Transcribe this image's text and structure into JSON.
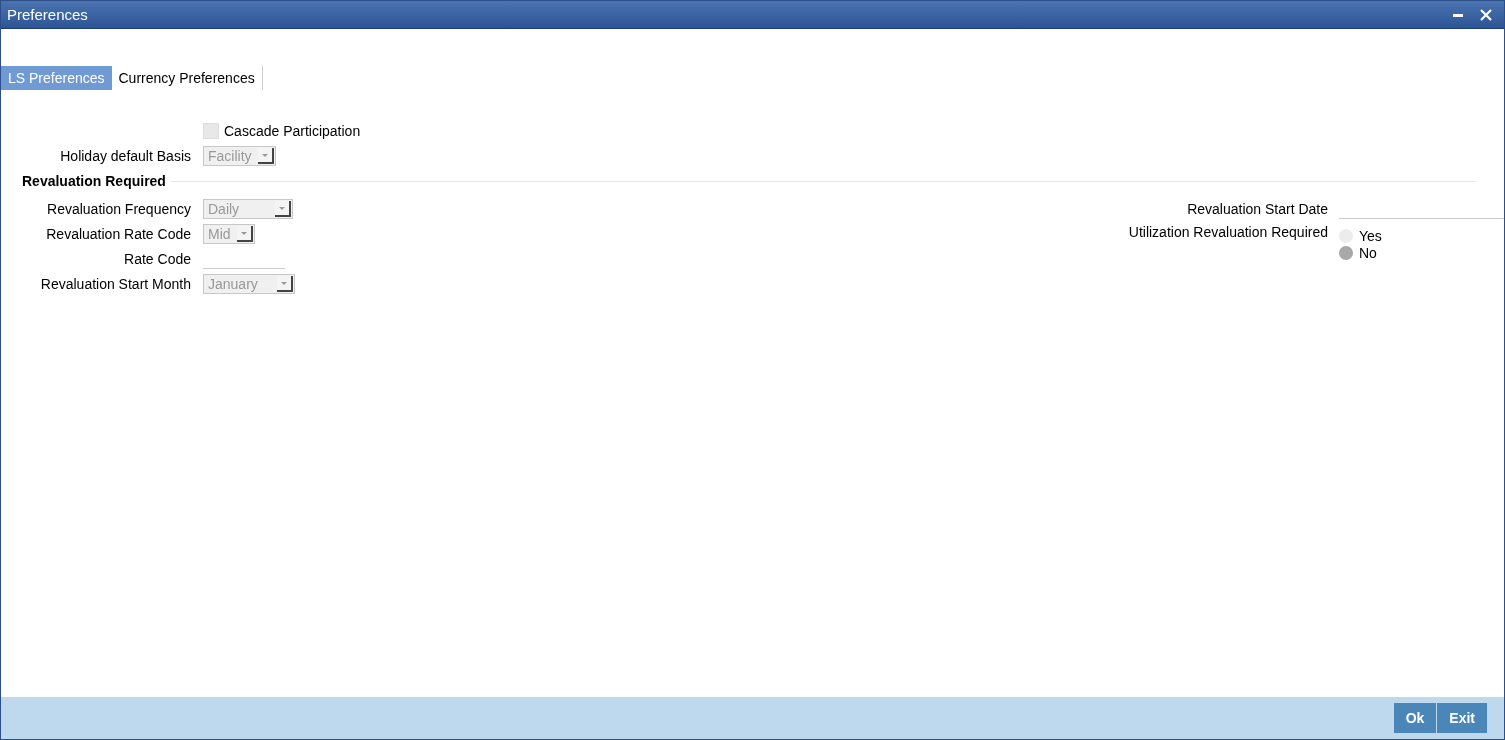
{
  "window": {
    "title": "Preferences"
  },
  "tabs": [
    {
      "label": "LS Preferences",
      "selected": true
    },
    {
      "label": "Currency Preferences",
      "selected": false
    }
  ],
  "cascade": {
    "label": "Cascade Participation",
    "checked": false
  },
  "holiday": {
    "label": "Holiday default Basis",
    "value": "Facility"
  },
  "section": {
    "title": "Revaluation Required"
  },
  "left_fields": [
    {
      "kind": "select",
      "label": "Revaluation Frequency",
      "value": "Daily"
    },
    {
      "kind": "select",
      "label": "Revaluation Rate Code",
      "value": "Mid"
    },
    {
      "kind": "text",
      "label": "Rate Code"
    },
    {
      "kind": "select",
      "label": "Revaluation Start Month",
      "value": "January"
    }
  ],
  "right_fields": [
    {
      "kind": "text",
      "label": "Revaluation Start Date"
    },
    {
      "kind": "radio",
      "label": "Utilization Revaluation Required",
      "options": [
        {
          "label": "Yes",
          "selected": false
        },
        {
          "label": "No",
          "selected": true
        }
      ]
    }
  ],
  "buttons": [
    "Ok",
    "Exit"
  ]
}
